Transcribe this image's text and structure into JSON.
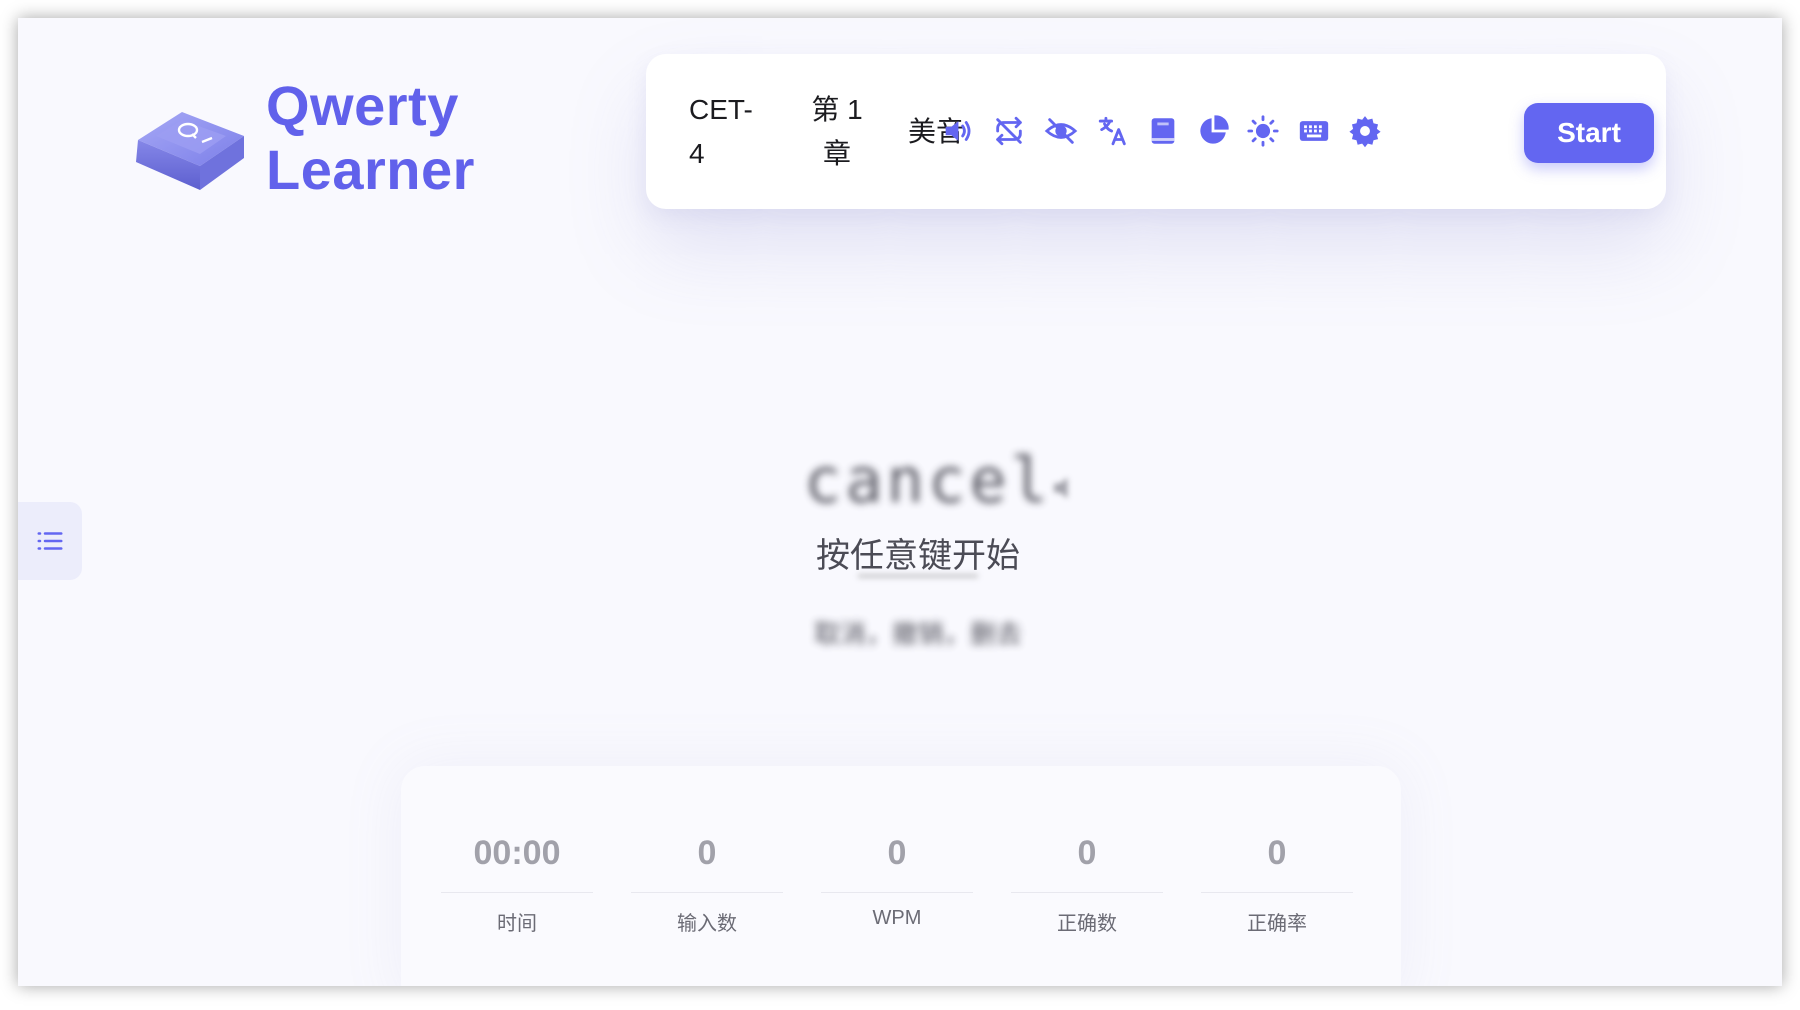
{
  "app": {
    "logo_line1": "Qwerty",
    "logo_line2": "Learner"
  },
  "toolbar": {
    "dictionary": "CET-4",
    "chapter": "第 1 章",
    "pronunciation": "美音",
    "icons": [
      "sound-icon",
      "loop-icon",
      "hide-word-icon",
      "translation-icon",
      "dictionary-book-icon",
      "analysis-chart-icon",
      "theme-light-icon",
      "keyboard-icon",
      "settings-icon"
    ],
    "start_label": "Start"
  },
  "practice": {
    "word": "cancel",
    "prompt": "按任意键开始",
    "translation": "取消，撤销，删去"
  },
  "stats": [
    {
      "value": "00:00",
      "label": "时间"
    },
    {
      "value": "0",
      "label": "输入数"
    },
    {
      "value": "0",
      "label": "WPM"
    },
    {
      "value": "0",
      "label": "正确数"
    },
    {
      "value": "0",
      "label": "正确率"
    }
  ],
  "colors": {
    "accent": "#6366f1",
    "logo": "#6161eb",
    "background": "#f9f9fe"
  }
}
